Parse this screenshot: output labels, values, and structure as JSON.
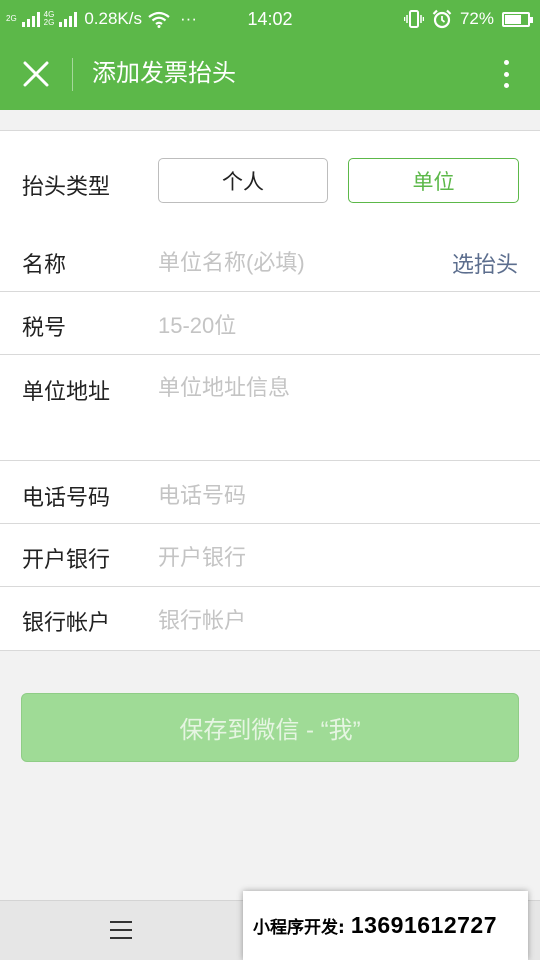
{
  "status_bar": {
    "network_top": "2G",
    "network_mid": "4G",
    "network_bottom": "2G",
    "speed": "0.28K/s",
    "more": "···",
    "time": "14:02",
    "battery": "72%",
    "battery_level": 0.72
  },
  "navbar": {
    "title": "添加发票抬头",
    "close_icon": "close-icon",
    "more_icon": "more-vertical-icon"
  },
  "form": {
    "type": {
      "label": "抬头类型",
      "options": [
        "个人",
        "单位"
      ],
      "selected": "单位"
    },
    "name": {
      "label": "名称",
      "placeholder": "单位名称(必填)",
      "action": "选抬头"
    },
    "tax_id": {
      "label": "税号",
      "placeholder": "15-20位"
    },
    "address": {
      "label": "单位地址",
      "placeholder": "单位地址信息"
    },
    "phone": {
      "label": "电话号码",
      "placeholder": "电话号码"
    },
    "bank": {
      "label": "开户银行",
      "placeholder": "开户银行"
    },
    "account": {
      "label": "银行帐户",
      "placeholder": "银行帐户"
    }
  },
  "save_button": "保存到微信 - “我”",
  "promo": {
    "label": "小程序开发:",
    "phone": "13691612727"
  },
  "colors": {
    "accent": "#5cb849",
    "save_disabled": "#9fdb96",
    "link": "#5c6e8e"
  }
}
